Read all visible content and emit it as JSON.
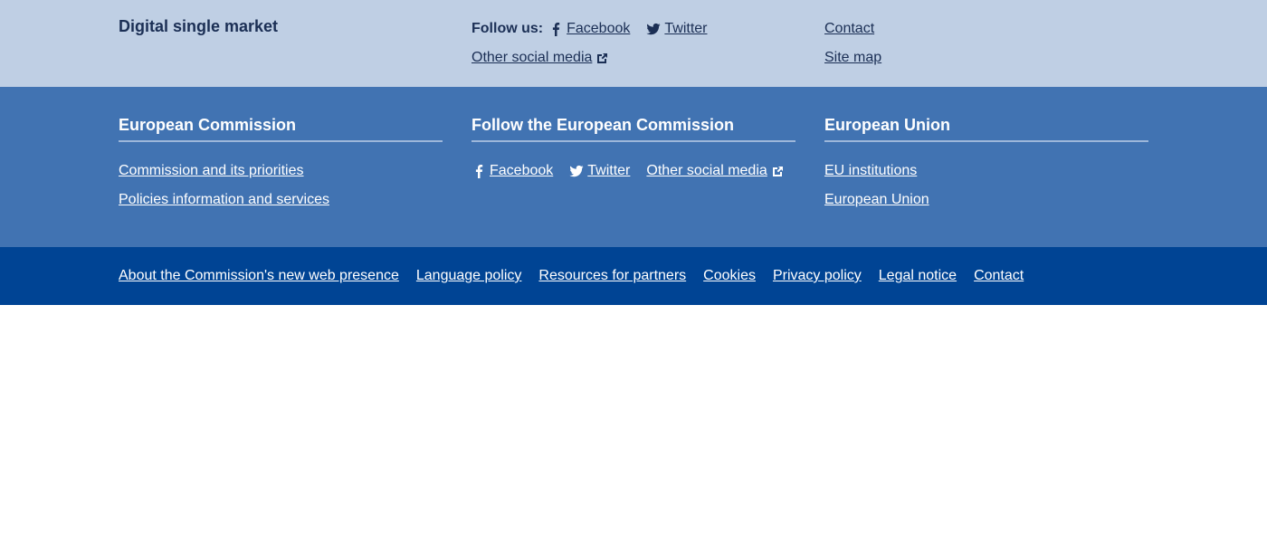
{
  "top": {
    "site_name": "Digital single market",
    "follow_label": "Follow us:",
    "facebook": "Facebook",
    "twitter": "Twitter",
    "other_social": "Other social media",
    "contact": "Contact",
    "site_map": "Site map"
  },
  "middle": {
    "commission": {
      "heading": "European Commission",
      "links": [
        "Commission and its priorities",
        "Policies information and services"
      ]
    },
    "follow": {
      "heading": "Follow the European Commission",
      "facebook": "Facebook",
      "twitter": "Twitter",
      "other_social": "Other social media"
    },
    "eu": {
      "heading": "European Union",
      "links": [
        "EU institutions",
        "European Union"
      ]
    }
  },
  "bottom": {
    "links": [
      "About the Commission's new web presence",
      "Language policy",
      "Resources for partners",
      "Cookies",
      "Privacy policy",
      "Legal notice",
      "Contact"
    ]
  },
  "colors": {
    "top_band": "#bfcfe4",
    "middle_band": "#4173b2",
    "bottom_band": "#004494",
    "dark_text": "#1b2f55"
  },
  "icons": {
    "facebook": "facebook-icon",
    "twitter": "twitter-icon",
    "external": "external-link-icon"
  }
}
